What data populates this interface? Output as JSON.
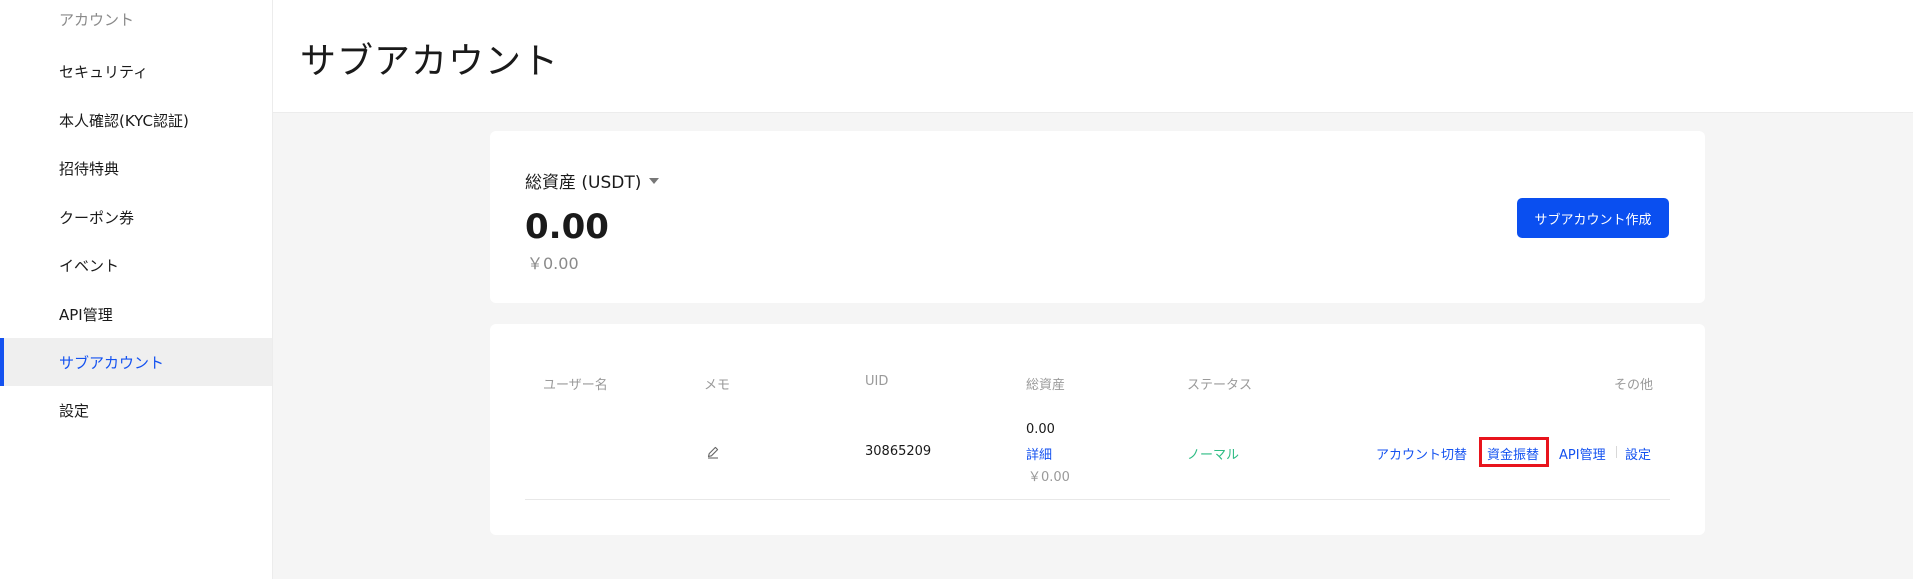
{
  "sidebar": {
    "items": [
      {
        "label": "アカウント"
      },
      {
        "label": "セキュリティ"
      },
      {
        "label": "本人確認(KYC認証)"
      },
      {
        "label": "招待特典"
      },
      {
        "label": "クーポン券"
      },
      {
        "label": "イベント"
      },
      {
        "label": "API管理"
      },
      {
        "label": "サブアカウント",
        "active": true
      },
      {
        "label": "設定"
      }
    ]
  },
  "header": {
    "title": "サブアカウント"
  },
  "assets": {
    "label": "総資産 (USDT)",
    "value": "0.00",
    "sub_value": "￥0.00",
    "create_button": "サブアカウント作成"
  },
  "table": {
    "headers": {
      "username": "ユーザー名",
      "memo": "メモ",
      "uid": "UID",
      "total_assets": "総資産",
      "status": "ステータス",
      "others": "その他"
    },
    "rows": [
      {
        "username": "",
        "uid": "30865209",
        "assets_value": "0.00",
        "assets_detail": "詳細",
        "assets_sub": "￥0.00",
        "status": "ノーマル",
        "actions": {
          "switch": "アカウント切替",
          "transfer": "資金振替",
          "api": "API管理",
          "settings": "設定"
        }
      }
    ]
  },
  "colors": {
    "accent": "#1452f0",
    "status_normal": "#2ebc84",
    "highlight": "#e8141c"
  }
}
